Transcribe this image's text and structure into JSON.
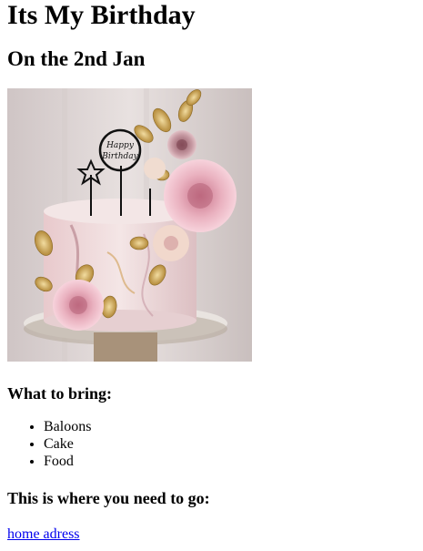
{
  "heading": "Its My Birthday",
  "subheading": "On the 2nd Jan",
  "image": {
    "subject": "pink-marble-birthday-cake-with-roses",
    "topper_text": "Happy Birthday"
  },
  "bring": {
    "title": "What to bring:",
    "items": [
      "Baloons",
      "Cake",
      "Food"
    ]
  },
  "location": {
    "title": "This is where you need to go:",
    "link_text": "home adress"
  },
  "colors": {
    "link": "#0000ee",
    "text": "#000000",
    "background": "#ffffff"
  }
}
